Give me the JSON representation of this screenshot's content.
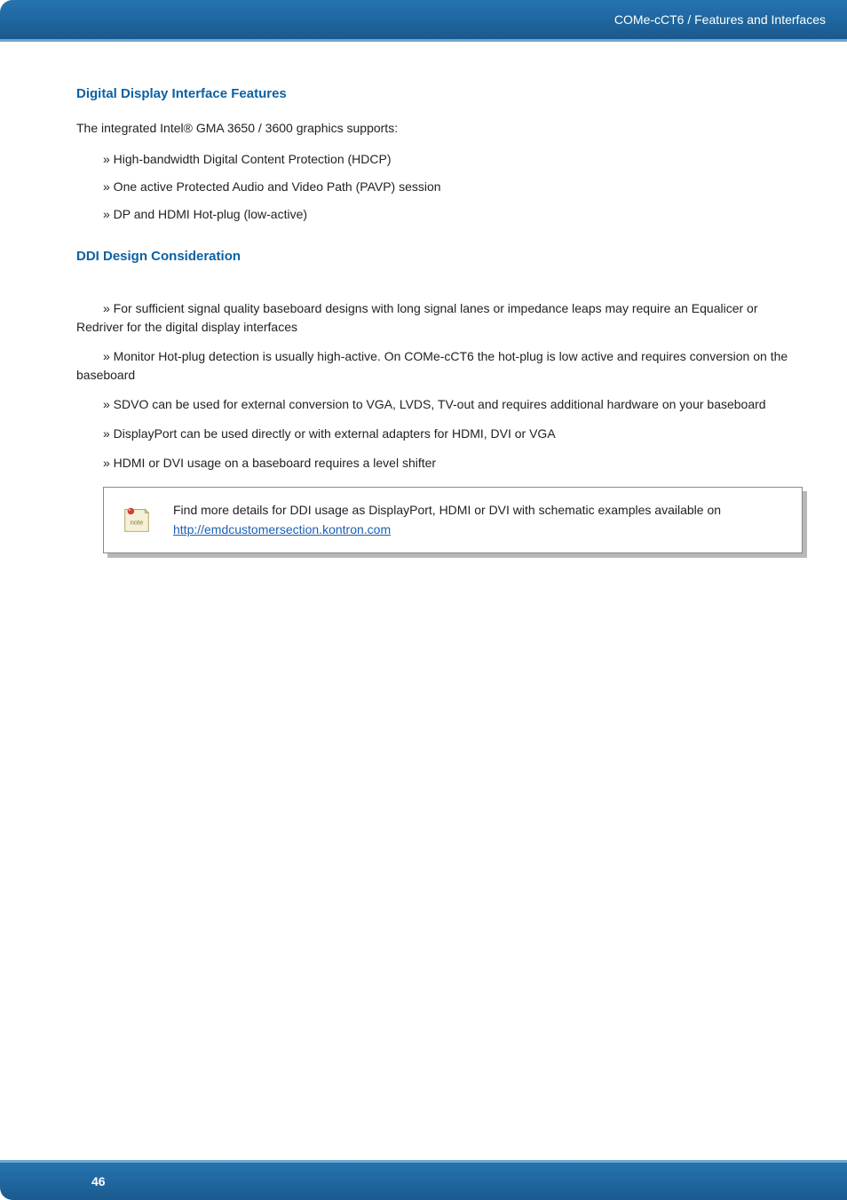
{
  "header": {
    "breadcrumb": "COMe-cCT6 / Features and Interfaces"
  },
  "section1": {
    "title": "Digital Display Interface Features",
    "intro": "The integrated Intel® GMA 3650 / 3600 graphics supports:",
    "bullets": [
      "» High-bandwidth Digital Content Protection (HDCP)",
      "» One active Protected Audio and Video Path (PAVP) session",
      "» DP and HDMI Hot-plug (low-active)"
    ]
  },
  "section2": {
    "title": "DDI Design Consideration",
    "paragraphs": [
      "» For sufficient signal quality baseboard designs with long signal lanes or impedance leaps may require an Equalicer or Redriver for the digital display interfaces",
      "» Monitor Hot-plug detection is usually high-active. On COMe-cCT6 the hot-plug is low active and requires conversion on the baseboard",
      "» SDVO can be used for external conversion to VGA, LVDS, TV-out and requires additional hardware on your baseboard",
      "» DisplayPort can be used directly or with external adapters for HDMI, DVI or VGA",
      "» HDMI or DVI usage on a baseboard requires a level shifter"
    ],
    "note": {
      "text_before": "Find more details for DDI usage as DisplayPort, HDMI or DVI with schematic examples available on ",
      "link_text": "http://emdcustomersection.kontron.com",
      "link_href": "http://emdcustomersection.kontron.com"
    }
  },
  "footer": {
    "page_number": "46"
  }
}
